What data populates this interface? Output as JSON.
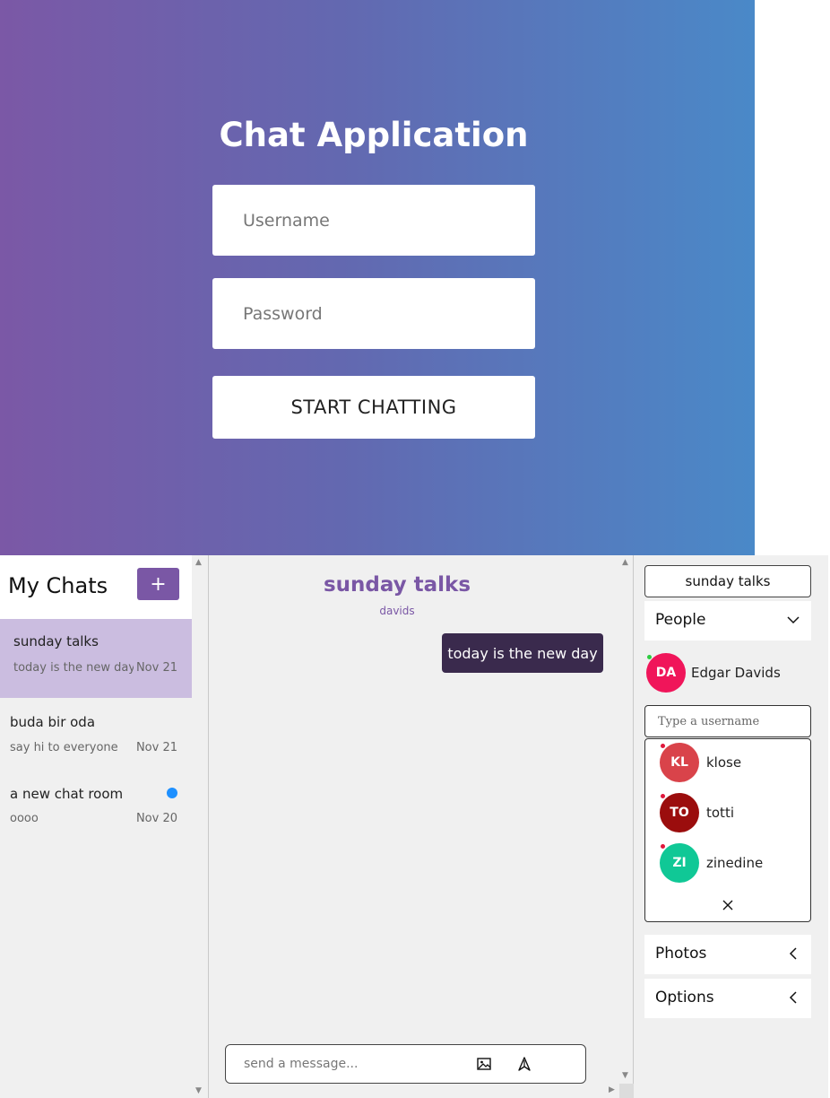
{
  "login": {
    "title": "Chat Application",
    "username_placeholder": "Username",
    "password_placeholder": "Password",
    "submit_label": "START CHATTING"
  },
  "sidebar": {
    "title": "My Chats",
    "add_label": "+",
    "chats": [
      {
        "name": "sunday talks",
        "last_message": "today is the new day",
        "date": "Nov 21",
        "active": true
      },
      {
        "name": "buda bir oda",
        "last_message": "say hi to everyone",
        "date": "Nov 21"
      },
      {
        "name": "a new chat room",
        "last_message": "oooo",
        "date": "Nov 20",
        "unread": true
      }
    ]
  },
  "room": {
    "title": "sunday talks",
    "subtitle": "davids",
    "messages": [
      {
        "text": "today is the new day",
        "own": true
      }
    ],
    "composer_placeholder": "send a message...",
    "icons": [
      "image-icon",
      "send-icon"
    ]
  },
  "settings": {
    "room_name": "sunday talks",
    "people_label": "People",
    "people": [
      {
        "initials": "DA",
        "name": "Edgar Davids",
        "color": "#f0155a",
        "online": true
      }
    ],
    "search_placeholder": "Type a username",
    "results": [
      {
        "initials": "KL",
        "name": "klose",
        "color": "#d9434a"
      },
      {
        "initials": "TO",
        "name": "totti",
        "color": "#9b0d0d"
      },
      {
        "initials": "ZI",
        "name": "zinedine",
        "color": "#10c896"
      }
    ],
    "photos_label": "Photos",
    "options_label": "Options"
  },
  "colors": {
    "accent": "#7a57a5",
    "bubble": "#3a2a4d",
    "active_chat": "#cbbde0",
    "unread": "#1e90ff",
    "online": "#2ecc40",
    "offline": "#e0173c"
  }
}
